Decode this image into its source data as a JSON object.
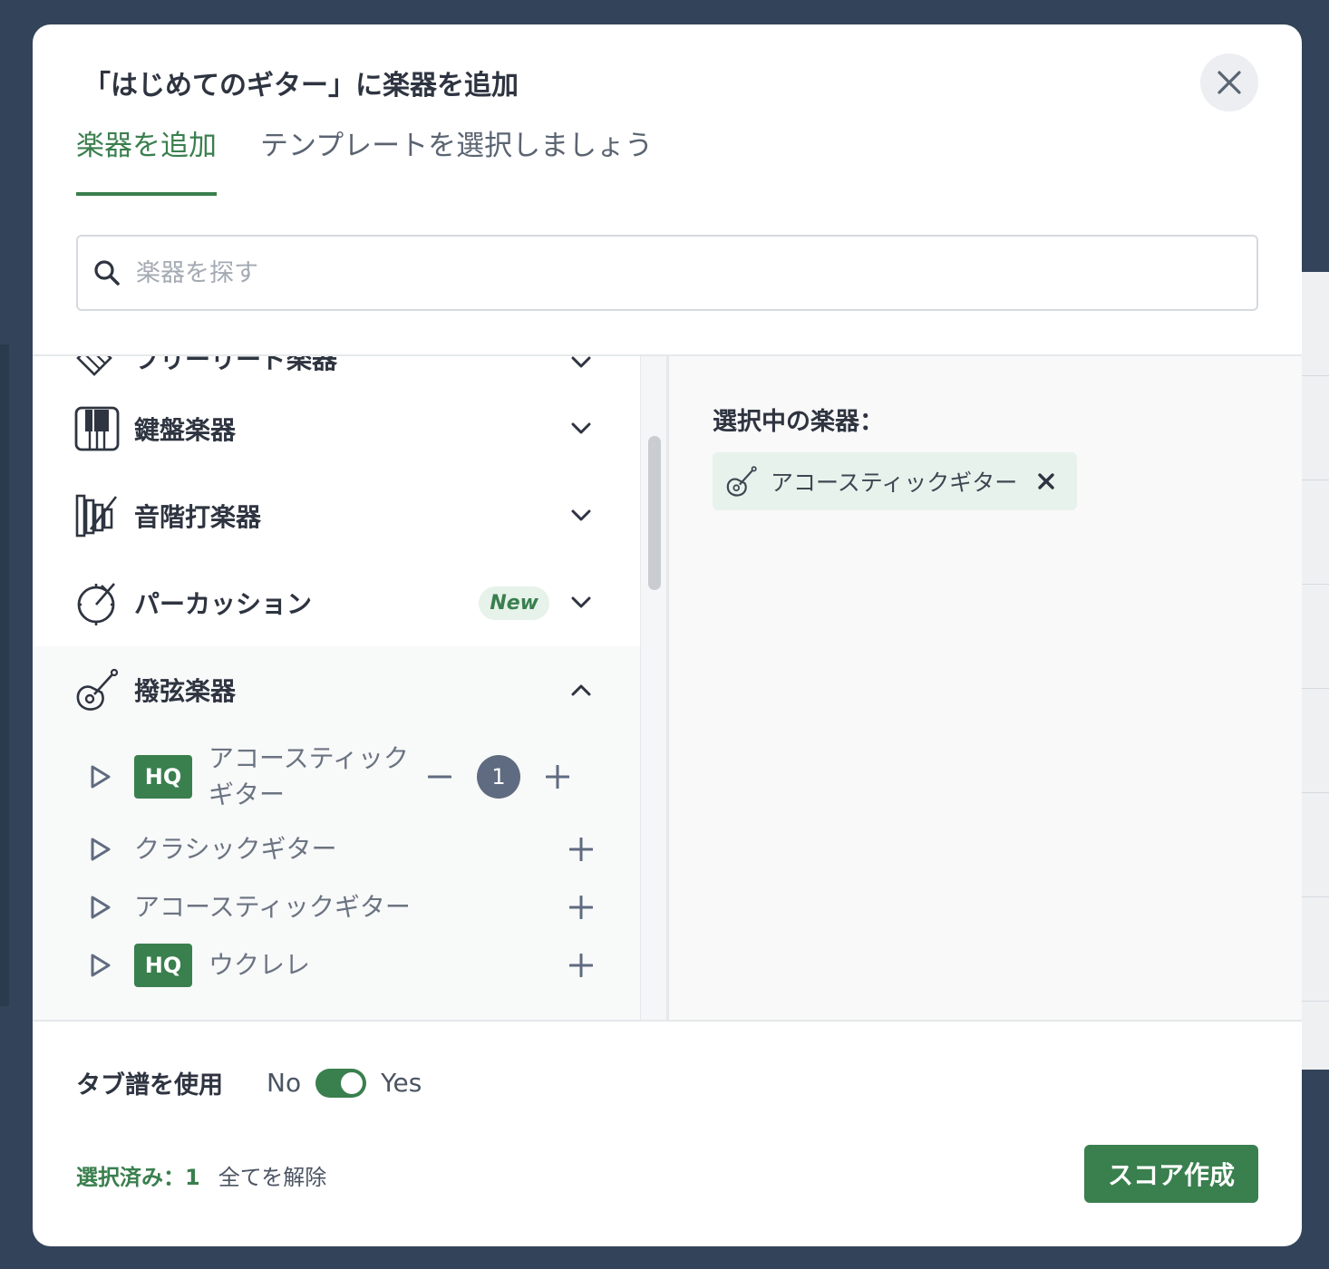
{
  "modal": {
    "title": "「はじめてのギター」に楽器を追加",
    "tabs": [
      {
        "label": "楽器を追加",
        "active": true
      },
      {
        "label": "テンプレートを選択しましょう",
        "active": false
      }
    ]
  },
  "search": {
    "placeholder": "楽器を探す"
  },
  "categories": [
    {
      "label": "フリーリード楽器",
      "icon": "accordion-icon",
      "expanded": false
    },
    {
      "label": "鍵盤楽器",
      "icon": "piano-keys-icon",
      "expanded": false
    },
    {
      "label": "音階打楽器",
      "icon": "xylophone-icon",
      "expanded": false
    },
    {
      "label": "パーカッション",
      "icon": "drum-icon",
      "badge": "New",
      "expanded": false
    },
    {
      "label": "撥弦楽器",
      "icon": "guitar-icon",
      "expanded": true
    }
  ],
  "instruments": [
    {
      "label": "アコースティックギター",
      "hq": "HQ",
      "count": "1"
    },
    {
      "label": "クラシックギター"
    },
    {
      "label": "アコースティックギター"
    },
    {
      "label": "ウクレレ",
      "hq": "HQ"
    }
  ],
  "selected": {
    "title": "選択中の楽器：",
    "chip_label": "アコースティックギター"
  },
  "tab_notation": {
    "label": "タブ譜を使用",
    "no": "No",
    "yes": "Yes",
    "enabled": true
  },
  "footer": {
    "selected_count": "選択済み：1",
    "clear_all": "全てを解除",
    "create_button": "スコア作成"
  },
  "colors": {
    "accent": "#3a7f4e",
    "backdrop": "#33445a",
    "count_badge": "#5f6b80"
  }
}
